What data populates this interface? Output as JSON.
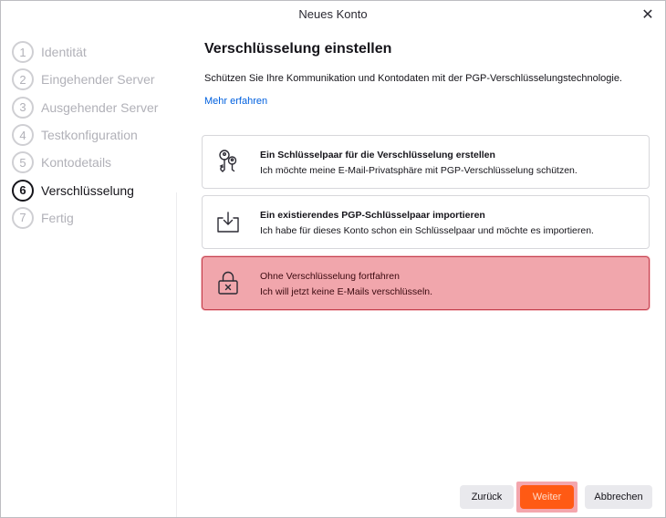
{
  "window": {
    "title": "Neues Konto"
  },
  "steps": [
    {
      "num": "1",
      "label": "Identität"
    },
    {
      "num": "2",
      "label": "Eingehender Server"
    },
    {
      "num": "3",
      "label": "Ausgehender Server"
    },
    {
      "num": "4",
      "label": "Testkonfiguration"
    },
    {
      "num": "5",
      "label": "Kontodetails"
    },
    {
      "num": "6",
      "label": "Verschlüsselung"
    },
    {
      "num": "7",
      "label": "Fertig"
    }
  ],
  "active_step": 6,
  "main": {
    "heading": "Verschlüsselung einstellen",
    "description": "Schützen Sie Ihre Kommunikation und Kontodaten mit der PGP-Verschlüsselungstechnologie.",
    "learn_more": "Mehr erfahren"
  },
  "options": [
    {
      "icon": "key-pair-icon",
      "title": "Ein Schlüsselpaar für die Verschlüsselung erstellen",
      "subtitle": "Ich möchte meine E-Mail-Privatsphäre mit PGP-Verschlüsselung schützen."
    },
    {
      "icon": "import-icon",
      "title": "Ein existierendes PGP-Schlüsselpaar importieren",
      "subtitle": "Ich habe für dieses Konto schon ein Schlüsselpaar und möchte es importieren."
    },
    {
      "icon": "lock-x-icon",
      "title": "Ohne Verschlüsselung fortfahren",
      "subtitle": "Ich will jetzt keine E-Mails verschlüsseln.",
      "selected": true
    }
  ],
  "buttons": {
    "back": "Zurück",
    "next": "Weiter",
    "cancel": "Abbrechen"
  },
  "colors": {
    "accent": "#ff5a14",
    "selected_bg": "#f1a6ac",
    "link": "#0060df"
  }
}
